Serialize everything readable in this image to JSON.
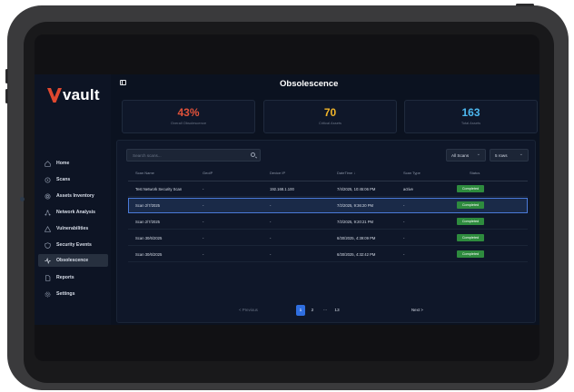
{
  "brand": {
    "logo_text": "vault",
    "logo_color": "#e0482f"
  },
  "sidebar": {
    "items": [
      {
        "label": "Home",
        "icon": "home-icon",
        "active": false
      },
      {
        "label": "Scans",
        "icon": "scan-icon",
        "active": false
      },
      {
        "label": "Assets Inventory",
        "icon": "assets-icon",
        "active": false
      },
      {
        "label": "Network Analysis",
        "icon": "network-icon",
        "active": false
      },
      {
        "label": "Vulnerabilities",
        "icon": "warning-icon",
        "active": false
      },
      {
        "label": "Security Events",
        "icon": "shield-icon",
        "active": false
      },
      {
        "label": "Obsolescence",
        "icon": "activity-icon",
        "active": true
      },
      {
        "label": "Reports",
        "icon": "document-icon",
        "active": false
      },
      {
        "label": "Settings",
        "icon": "gear-icon",
        "active": false
      }
    ]
  },
  "header": {
    "title": "Obsolescence"
  },
  "stats": [
    {
      "value": "43%",
      "label": "Overall Obsolescence",
      "color": "#e0523a"
    },
    {
      "value": "70",
      "label": "Critical Assets",
      "color": "#f0b429"
    },
    {
      "value": "163",
      "label": "Total Assets",
      "color": "#4db8f0"
    }
  ],
  "toolbar": {
    "search_placeholder": "Search scans...",
    "filter_value": "All Scans",
    "rows_value": "5 rows"
  },
  "table": {
    "columns": [
      "Scan Name",
      "GeoIP",
      "Device IP",
      "DateTime ↓",
      "Scan Type",
      "Status"
    ],
    "rows": [
      {
        "name": "Test Network Security Scan",
        "geo": "-",
        "ip": "192.168.1.100",
        "datetime": "7/4/2025, 10:45:06 PM",
        "type": "active",
        "status": "Completed",
        "selected": false
      },
      {
        "name": "Scan 2/7/2025",
        "geo": "-",
        "ip": "-",
        "datetime": "7/2/2025, 9:36:20 PM",
        "type": "-",
        "status": "Completed",
        "selected": true
      },
      {
        "name": "Scan 2/7/2025",
        "geo": "-",
        "ip": "-",
        "datetime": "7/2/2025, 9:20:21 PM",
        "type": "-",
        "status": "Completed",
        "selected": false
      },
      {
        "name": "Scan 30/6/2025",
        "geo": "-",
        "ip": "-",
        "datetime": "6/30/2025, 4:39:09 PM",
        "type": "-",
        "status": "Completed",
        "selected": false
      },
      {
        "name": "Scan 30/6/2025",
        "geo": "-",
        "ip": "-",
        "datetime": "6/30/2025, 4:32:42 PM",
        "type": "-",
        "status": "Completed",
        "selected": false
      }
    ]
  },
  "pagination": {
    "previous": "< Previous",
    "pages": [
      "1",
      "2"
    ],
    "current": "1",
    "ellipsis": "...",
    "last": "13",
    "next": "Next >"
  }
}
